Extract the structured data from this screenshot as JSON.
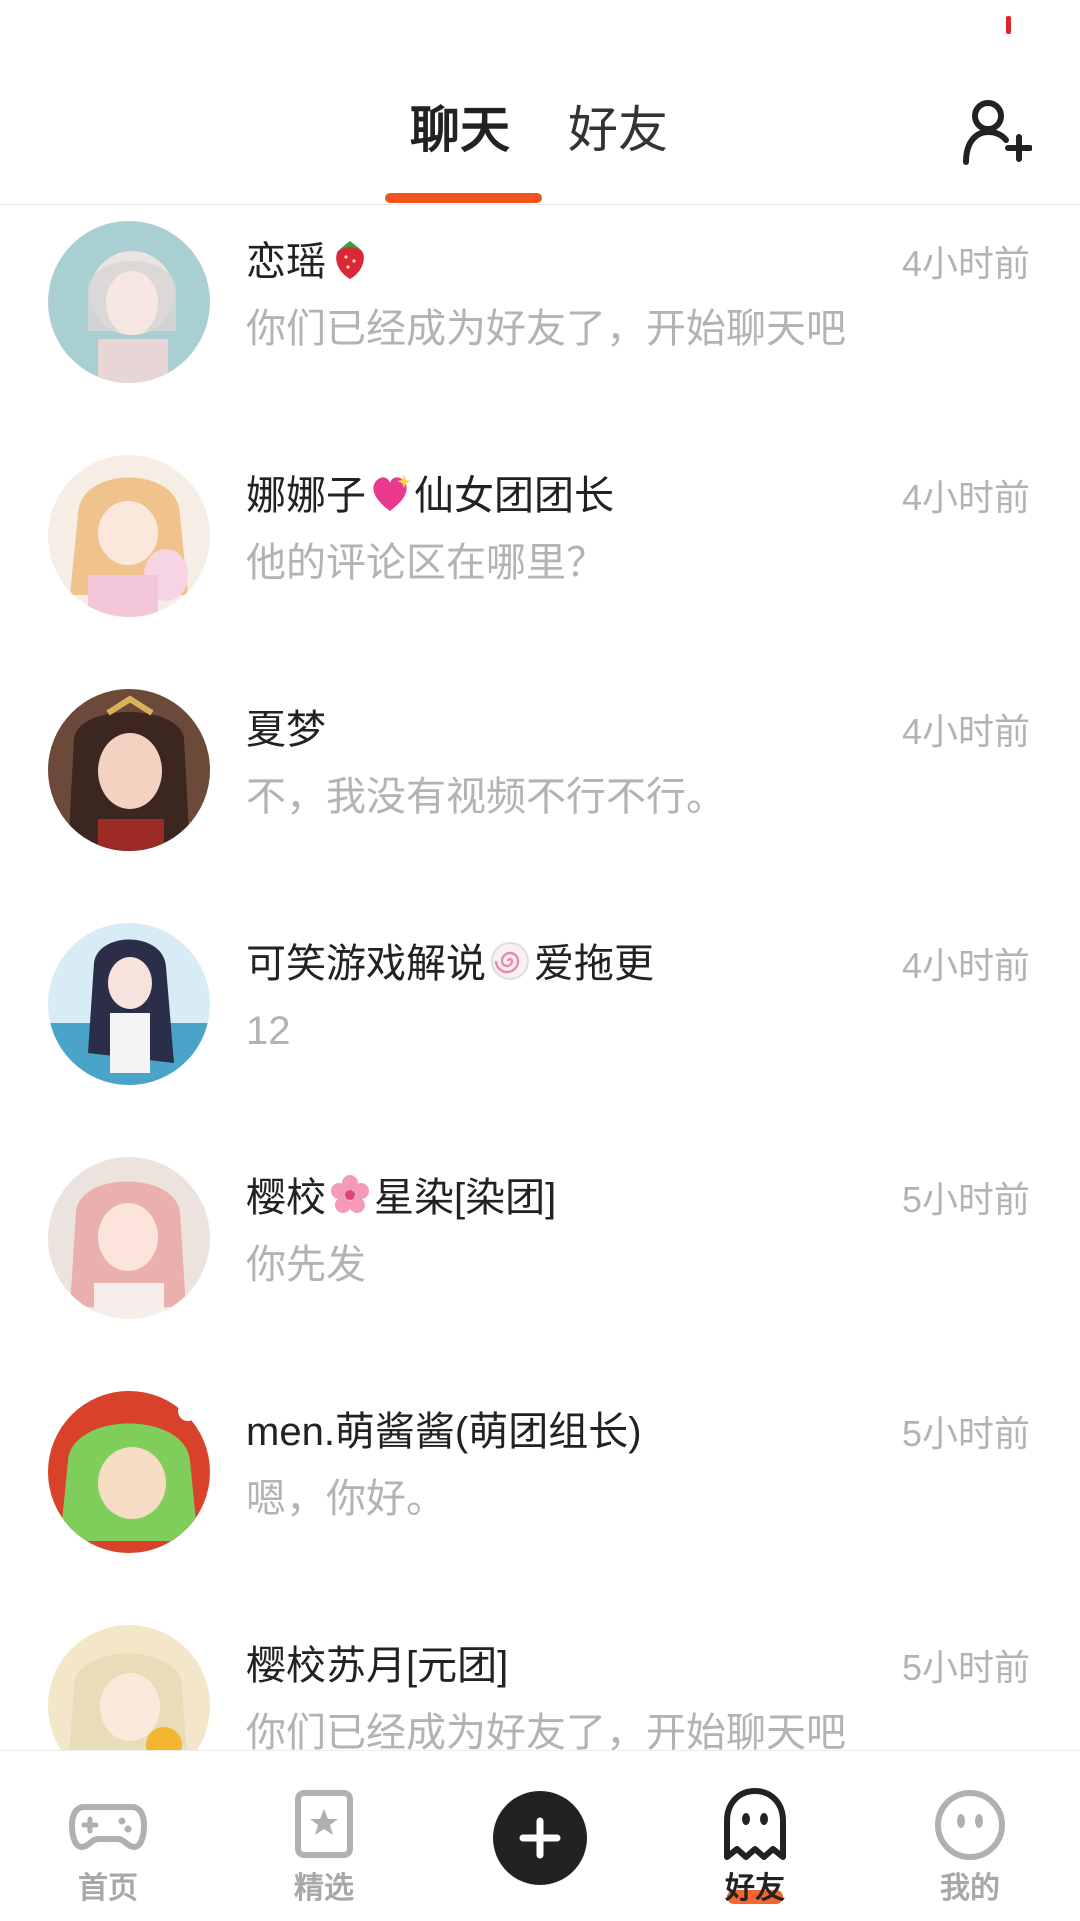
{
  "header": {
    "tabs": [
      {
        "label": "聊天",
        "active": true
      },
      {
        "label": "好友",
        "active": false
      }
    ],
    "accent_color": "#f2541b",
    "add_friend_icon": "add-user-icon"
  },
  "chats": [
    {
      "name_parts": [
        "恋瑶"
      ],
      "emoji": [
        "strawberry"
      ],
      "message": "你们已经成为好友了，开始聊天吧",
      "time": "4小时前"
    },
    {
      "name_parts": [
        "娜娜子",
        "仙女团团长"
      ],
      "emoji": [
        "sparkling-heart"
      ],
      "message": "他的评论区在哪里？",
      "time": "4小时前"
    },
    {
      "name_parts": [
        "夏梦"
      ],
      "emoji": [],
      "message": " 不，我没有视频不行不行。",
      "time": "4小时前"
    },
    {
      "name_parts": [
        "可笑游戏解说",
        "爱拖更"
      ],
      "emoji": [
        "fish-cake"
      ],
      "message": "12",
      "time": "4小时前"
    },
    {
      "name_parts": [
        "樱校",
        "星染[染团]"
      ],
      "emoji": [
        "cherry-blossom"
      ],
      "message": "你先发",
      "time": "5小时前"
    },
    {
      "name_parts": [
        "men.萌酱酱(萌团组长)"
      ],
      "emoji": [],
      "message": "嗯，你好。",
      "time": "5小时前"
    },
    {
      "name_parts": [
        "樱校苏月[元团]"
      ],
      "emoji": [],
      "message": "你们已经成为好友了，开始聊天吧",
      "time": "5小时前"
    }
  ],
  "bottom_nav": [
    {
      "label": "首页",
      "icon": "gamepad-icon",
      "active": false
    },
    {
      "label": "精选",
      "icon": "star-bookmark-icon",
      "active": false
    },
    {
      "label": "",
      "icon": "plus-icon",
      "active": false
    },
    {
      "label": "好友",
      "icon": "ghost-icon",
      "active": true
    },
    {
      "label": "我的",
      "icon": "face-icon",
      "active": false
    }
  ]
}
